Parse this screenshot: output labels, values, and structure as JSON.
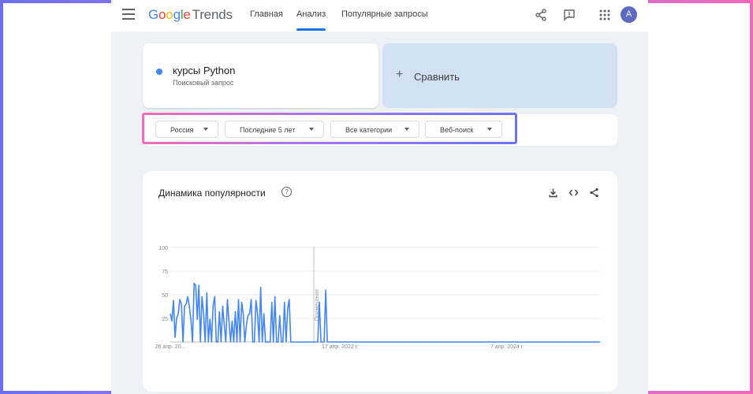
{
  "header": {
    "logo_google": "Google",
    "logo_trends": "Trends",
    "tabs": [
      {
        "label": "Главная"
      },
      {
        "label": "Анализ",
        "active": true
      },
      {
        "label": "Популярные запросы"
      }
    ],
    "avatar_letter": "A",
    "icons": [
      "share-icon",
      "feedback-icon",
      "apps-icon"
    ]
  },
  "search_term": {
    "name": "курсы Python",
    "type": "Поисковый запрос",
    "color": "#4285f4"
  },
  "compare": {
    "plus": "+",
    "label": "Сравнить"
  },
  "filters": [
    {
      "label": "Россия"
    },
    {
      "label": "Последние 5 лет"
    },
    {
      "label": "Все категории"
    },
    {
      "label": "Веб-поиск"
    }
  ],
  "card": {
    "title": "Динамика популярности",
    "help": "?",
    "icons": [
      "download-icon",
      "embed-icon",
      "share-icon"
    ]
  },
  "chart_data": {
    "type": "line",
    "series": [
      {
        "color": "#4285f4",
        "values": [
          30,
          22,
          44,
          5,
          25,
          30,
          45,
          40,
          0,
          38,
          40,
          48,
          38,
          24,
          0,
          62,
          60,
          24,
          60,
          0,
          48,
          30,
          0,
          52,
          0,
          24,
          0,
          38,
          48,
          0,
          0,
          32,
          0,
          38,
          18,
          0,
          45,
          22,
          0,
          22,
          0,
          32,
          0,
          45,
          0,
          42,
          30,
          0,
          18,
          28,
          30,
          45,
          0,
          0,
          44,
          30,
          0,
          58,
          0,
          30,
          0,
          0,
          0,
          0,
          42,
          0,
          48,
          0,
          0,
          28,
          0,
          0,
          42,
          0,
          35,
          45,
          0,
          0,
          0,
          0,
          0,
          0,
          0,
          0,
          0,
          0,
          0,
          0,
          0,
          0,
          0,
          0,
          0,
          0,
          42,
          0,
          0,
          0,
          55,
          0,
          0,
          0,
          0,
          0,
          0,
          0,
          0,
          0,
          0,
          0,
          0,
          0,
          0,
          0,
          0,
          0,
          0,
          0,
          0,
          0,
          0,
          0,
          0,
          0,
          0,
          0,
          0,
          0,
          0,
          0,
          0,
          0,
          0,
          0,
          0,
          0,
          0,
          0,
          0,
          0,
          0,
          0,
          0,
          0,
          0,
          0,
          0,
          0,
          0,
          0,
          0,
          0,
          0,
          0,
          0,
          0,
          0,
          0,
          0,
          0,
          0,
          0,
          0,
          0,
          0,
          0,
          0,
          0,
          0,
          0,
          0,
          0,
          0,
          0,
          0,
          0,
          0,
          0,
          0,
          0,
          0,
          0,
          0,
          0,
          0,
          0,
          0,
          0,
          0,
          0,
          0,
          0,
          0,
          0,
          0,
          0,
          0,
          0,
          0,
          0,
          0,
          0,
          0,
          0,
          0,
          0,
          0,
          0,
          0,
          0,
          0,
          0,
          0,
          0,
          0,
          0,
          0,
          0,
          0,
          0,
          0,
          0,
          0,
          0,
          0,
          0,
          0,
          0,
          0,
          0,
          0,
          0,
          0,
          0,
          0,
          0,
          0,
          0,
          0,
          0,
          0,
          0,
          0,
          0,
          0,
          0,
          0,
          0,
          0,
          0,
          0,
          0,
          0,
          0,
          0,
          0,
          0,
          0,
          0,
          0,
          0,
          0,
          0,
          0,
          0,
          0,
          0,
          0,
          0,
          0,
          0,
          0
        ]
      }
    ],
    "y_ticks": [
      "100",
      "75",
      "50",
      "25"
    ],
    "ylim": [
      0,
      100
    ],
    "x_tick_labels": [
      "26 апр. 20...",
      "17 апр. 2022 г.",
      "7 апр. 2024 г."
    ],
    "annotation": "Примечание"
  }
}
